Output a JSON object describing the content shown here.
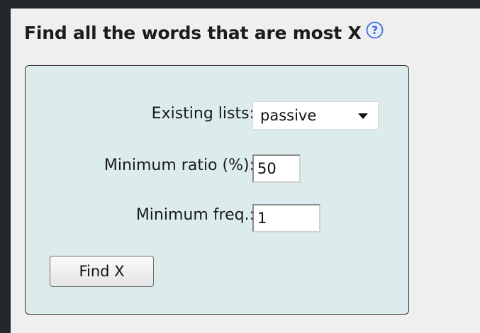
{
  "header": {
    "title": "Find all the words that are most X",
    "help_icon": "question-circle-icon"
  },
  "form": {
    "existing_lists_label": "Existing lists:",
    "existing_lists_value": "passive",
    "min_ratio_label": "Minimum ratio (%):",
    "min_ratio_value": "50",
    "min_freq_label": "Minimum freq.:",
    "min_freq_value": "1",
    "submit_label": "Find X"
  },
  "colors": {
    "outer_background": "#24272b",
    "panel_background": "#efefef",
    "form_background": "#dcecec",
    "help_icon_blue": "#3b6fd4"
  }
}
